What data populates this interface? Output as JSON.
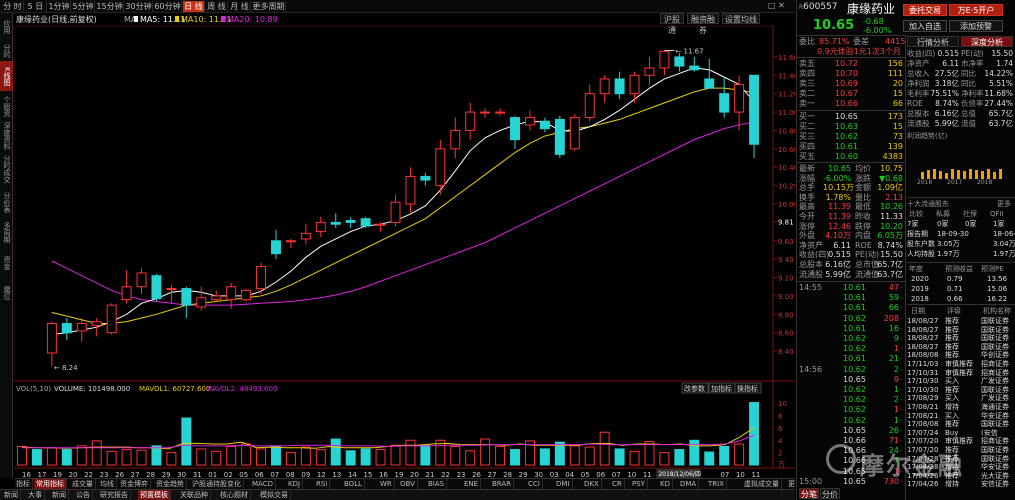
{
  "toolbar": {
    "tabs": [
      "分 时",
      "5 日",
      "1分钟",
      "5分钟",
      "15分钟",
      "30分钟",
      "60分钟",
      "日 线",
      "周 线",
      "月 线",
      "更多周期"
    ],
    "active_index": 7,
    "right_buttons": [
      "沪股通",
      "融资融券",
      "设置均线"
    ]
  },
  "left_strip": [
    {
      "label": "应用",
      "active": false
    },
    {
      "label": "分时图",
      "active": false
    },
    {
      "label": "K线图",
      "active": true
    },
    {
      "label": "个股资料",
      "active": false
    },
    {
      "label": "深度资料",
      "active": false
    },
    {
      "label": "分时成交",
      "active": false
    },
    {
      "label": "分价表",
      "active": false
    },
    {
      "label": "多周期",
      "active": false
    },
    {
      "label": "资金",
      "active": false
    },
    {
      "label": "魔位",
      "active": false
    }
  ],
  "chart_header": {
    "name": "康缘药业",
    "mode": "(日线,前复权)",
    "ma_label": "MA",
    "ma5": "MA5: 11.11",
    "ma10": "MA10: 11.21",
    "ma20": "MA20: 10.89",
    "ma5_color": "#ffffff",
    "ma10_color": "#e8d000",
    "ma20_color": "#e020e0",
    "high_label": "11.67",
    "low_label": "8.24"
  },
  "price_axis": [
    "11.60",
    "11.40",
    "11.20",
    "11.00",
    "10.80",
    "10.60",
    "10.40",
    "10.20",
    "10.00",
    "9.81",
    "9.60",
    "9.40",
    "9.20",
    "9.00",
    "8.80",
    "8.60",
    "8.40"
  ],
  "volume_header": {
    "vol": "VOL(5,10)",
    "volume": "VOLUME: 101498.000",
    "mavol1": "MAVOL1: 60727.600",
    "mavol2": "MAVOL2: 48493.600",
    "buttons": [
      "改参数",
      "加指标",
      "换指标"
    ]
  },
  "volume_axis": [
    "10",
    "8",
    "6",
    "4",
    "2"
  ],
  "volume_unit": "万",
  "date_axis": [
    "16",
    "17",
    "19",
    "20",
    "22",
    "23",
    "26",
    "27",
    "28",
    "29",
    "30",
    "31",
    "01",
    "02",
    "05",
    "06",
    "07",
    "08",
    "09",
    "12",
    "13",
    "14",
    "15",
    "16",
    "19",
    "20",
    "21",
    "22",
    "23",
    "26",
    "27",
    "28",
    "29",
    "30",
    "03",
    "04",
    "05",
    "06",
    "07",
    "10",
    "11",
    "12",
    "04",
    "05",
    "06",
    "07",
    "10",
    "11"
  ],
  "date_highlight": "2018/12/06/四",
  "indicator_tabs": [
    "指标",
    "常用指标",
    "成交量",
    "均线",
    "资金博弈",
    "资金趋势",
    "沪股通持股变化",
    "MACD",
    "KDJ",
    "RSI",
    "BOLL",
    "WR",
    "OBV",
    "BIAS",
    "ENE",
    "BRAR",
    "CCI",
    "DMI",
    "DKX",
    "CR",
    "PSY",
    "KD",
    "DMA",
    "TRIX",
    "虚拟成交量",
    "更多指标"
  ],
  "indicator_active": 1,
  "nav_tabs": [
    "新闻",
    "大事",
    "新闻",
    "公告",
    "研究报告",
    "预置模板",
    "关联品种",
    "核心题材",
    "模拟交易"
  ],
  "nav_active": 5,
  "chart_data": {
    "type": "candlestick",
    "ylim": [
      8.24,
      11.78
    ],
    "candles": [
      {
        "o": 8.38,
        "h": 8.72,
        "l": 8.24,
        "c": 8.7
      },
      {
        "o": 8.7,
        "h": 8.76,
        "l": 8.52,
        "c": 8.6
      },
      {
        "o": 8.62,
        "h": 8.76,
        "l": 8.5,
        "c": 8.7
      },
      {
        "o": 8.68,
        "h": 8.76,
        "l": 8.56,
        "c": 8.72
      },
      {
        "o": 8.6,
        "h": 8.92,
        "l": 8.58,
        "c": 8.9
      },
      {
        "o": 8.96,
        "h": 9.28,
        "l": 8.92,
        "c": 9.1
      },
      {
        "o": 9.1,
        "h": 9.3,
        "l": 9.02,
        "c": 9.25
      },
      {
        "o": 9.22,
        "h": 9.24,
        "l": 8.94,
        "c": 8.97
      },
      {
        "o": 9.08,
        "h": 9.12,
        "l": 8.92,
        "c": 9.08
      },
      {
        "o": 9.08,
        "h": 9.1,
        "l": 8.76,
        "c": 8.9
      },
      {
        "o": 8.88,
        "h": 9.1,
        "l": 8.84,
        "c": 8.98
      },
      {
        "o": 8.96,
        "h": 9.06,
        "l": 8.94,
        "c": 9.0
      },
      {
        "o": 8.96,
        "h": 9.14,
        "l": 8.86,
        "c": 9.1
      },
      {
        "o": 8.96,
        "h": 9.08,
        "l": 8.94,
        "c": 9.06
      },
      {
        "o": 9.08,
        "h": 9.36,
        "l": 9.02,
        "c": 9.32
      },
      {
        "o": 9.6,
        "h": 9.72,
        "l": 9.4,
        "c": 9.46
      },
      {
        "o": 9.6,
        "h": 9.62,
        "l": 9.52,
        "c": 9.6
      },
      {
        "o": 9.62,
        "h": 9.78,
        "l": 9.56,
        "c": 9.68
      },
      {
        "o": 9.7,
        "h": 9.86,
        "l": 9.64,
        "c": 9.8
      },
      {
        "o": 9.8,
        "h": 9.9,
        "l": 9.74,
        "c": 9.78
      },
      {
        "o": 9.82,
        "h": 9.86,
        "l": 9.74,
        "c": 9.8
      },
      {
        "o": 9.84,
        "h": 9.86,
        "l": 9.74,
        "c": 9.76
      },
      {
        "o": 9.78,
        "h": 9.8,
        "l": 9.7,
        "c": 9.78
      },
      {
        "o": 9.8,
        "h": 10.1,
        "l": 9.76,
        "c": 10.02
      },
      {
        "o": 10.0,
        "h": 10.4,
        "l": 9.9,
        "c": 10.3
      },
      {
        "o": 10.3,
        "h": 10.34,
        "l": 10.2,
        "c": 10.26
      },
      {
        "o": 10.2,
        "h": 10.7,
        "l": 10.1,
        "c": 10.6
      },
      {
        "o": 10.6,
        "h": 10.94,
        "l": 10.5,
        "c": 10.8
      },
      {
        "o": 10.8,
        "h": 11.1,
        "l": 10.7,
        "c": 11.0
      },
      {
        "o": 11.0,
        "h": 11.04,
        "l": 10.94,
        "c": 11.0
      },
      {
        "o": 11.0,
        "h": 11.04,
        "l": 10.96,
        "c": 11.0
      },
      {
        "o": 10.94,
        "h": 10.96,
        "l": 10.6,
        "c": 10.7
      },
      {
        "o": 10.86,
        "h": 11.02,
        "l": 10.8,
        "c": 10.94
      },
      {
        "o": 10.9,
        "h": 10.94,
        "l": 10.78,
        "c": 10.82
      },
      {
        "o": 10.92,
        "h": 10.96,
        "l": 10.5,
        "c": 10.54
      },
      {
        "o": 10.6,
        "h": 10.98,
        "l": 10.58,
        "c": 10.94
      },
      {
        "o": 10.94,
        "h": 11.3,
        "l": 10.9,
        "c": 11.2
      },
      {
        "o": 11.2,
        "h": 11.4,
        "l": 11.1,
        "c": 11.36
      },
      {
        "o": 11.36,
        "h": 11.44,
        "l": 11.14,
        "c": 11.2
      },
      {
        "o": 11.2,
        "h": 11.44,
        "l": 11.1,
        "c": 11.4
      },
      {
        "o": 11.4,
        "h": 11.6,
        "l": 11.3,
        "c": 11.48
      },
      {
        "o": 11.48,
        "h": 11.67,
        "l": 11.4,
        "c": 11.66
      },
      {
        "o": 11.6,
        "h": 11.64,
        "l": 11.44,
        "c": 11.5
      },
      {
        "o": 11.5,
        "h": 11.6,
        "l": 11.44,
        "c": 11.46
      },
      {
        "o": 11.36,
        "h": 11.58,
        "l": 11.26,
        "c": 11.26
      },
      {
        "o": 11.2,
        "h": 11.38,
        "l": 10.94,
        "c": 11.0
      },
      {
        "o": 11.0,
        "h": 11.4,
        "l": 10.8,
        "c": 11.3
      },
      {
        "o": 11.4,
        "h": 11.4,
        "l": 10.5,
        "c": 10.65
      }
    ],
    "ma5": [
      8.58,
      8.6,
      8.63,
      8.66,
      8.72,
      8.8,
      8.92,
      8.97,
      9.04,
      9.06,
      9.04,
      9.0,
      9.0,
      9.0,
      9.05,
      9.15,
      9.27,
      9.42,
      9.54,
      9.62,
      9.7,
      9.76,
      9.78,
      9.82,
      9.89,
      9.98,
      10.15,
      10.36,
      10.58,
      10.72,
      10.8,
      10.86,
      10.9,
      10.89,
      10.8,
      10.79,
      10.84,
      10.92,
      11.02,
      11.14,
      11.26,
      11.36,
      11.42,
      11.48,
      11.46,
      11.38,
      11.3,
      11.11
    ],
    "ma10": [
      8.82,
      8.78,
      8.74,
      8.7,
      8.7,
      8.72,
      8.76,
      8.8,
      8.85,
      8.9,
      8.92,
      8.94,
      8.96,
      8.98,
      9.0,
      9.05,
      9.12,
      9.2,
      9.28,
      9.36,
      9.44,
      9.52,
      9.6,
      9.68,
      9.76,
      9.84,
      9.96,
      10.08,
      10.2,
      10.32,
      10.44,
      10.56,
      10.66,
      10.74,
      10.78,
      10.82,
      10.84,
      10.88,
      10.92,
      10.98,
      11.04,
      11.1,
      11.16,
      11.22,
      11.26,
      11.26,
      11.24,
      11.21
    ],
    "ma20": [
      9.38,
      9.3,
      9.22,
      9.14,
      9.06,
      9.0,
      8.96,
      8.94,
      8.92,
      8.9,
      8.9,
      8.9,
      8.9,
      8.91,
      8.92,
      8.93,
      8.94,
      8.96,
      8.98,
      9.01,
      9.05,
      9.1,
      9.16,
      9.22,
      9.28,
      9.34,
      9.4,
      9.46,
      9.52,
      9.58,
      9.66,
      9.74,
      9.82,
      9.9,
      9.98,
      10.06,
      10.14,
      10.22,
      10.3,
      10.38,
      10.46,
      10.54,
      10.62,
      10.7,
      10.76,
      10.82,
      10.86,
      10.89
    ],
    "volumes": [
      3.0,
      2.5,
      2.8,
      2.5,
      3.1,
      3.9,
      2.2,
      2.5,
      2.4,
      3.1,
      2.0,
      7.6,
      2.6,
      2.2,
      3.0,
      3.4,
      2.6,
      3.1,
      2.0,
      2.9,
      2.5,
      4.2,
      2.3,
      2.6,
      2.5,
      3.2,
      4.0,
      3.2,
      4.0,
      3.0,
      2.3,
      4.2,
      3.0,
      2.5,
      3.9,
      2.6,
      3.7,
      3.1,
      2.9,
      5.3,
      2.6,
      2.2,
      3.8,
      2.0,
      2.5,
      4.0,
      2.1,
      3.0,
      3.4,
      10.1
    ],
    "mavol1": [
      2.9,
      2.8,
      2.8,
      2.7,
      2.8,
      2.9,
      2.9,
      2.9,
      2.8,
      2.8,
      2.6,
      3.5,
      3.5,
      3.4,
      3.4,
      3.7,
      2.8,
      2.9,
      2.8,
      2.8,
      2.7,
      3.0,
      2.8,
      2.8,
      2.8,
      3.0,
      3.2,
      3.2,
      3.4,
      3.5,
      3.3,
      3.3,
      3.3,
      3.2,
      3.4,
      3.2,
      3.2,
      3.2,
      3.2,
      3.5,
      3.5,
      3.2,
      3.4,
      3.4,
      3.3,
      3.4,
      3.1,
      3.1,
      3.3,
      4.5,
      6.07
    ],
    "mavol2": [
      2.8,
      2.8,
      2.8,
      2.8,
      2.8,
      2.8,
      2.8,
      2.8,
      2.8,
      2.8,
      2.8,
      3.2,
      3.1,
      3.1,
      3.1,
      3.2,
      3.1,
      3.1,
      3.1,
      3.2,
      3.2,
      3.2,
      3.1,
      3.1,
      3.1,
      3.0,
      3.1,
      3.1,
      3.1,
      3.2,
      3.2,
      3.2,
      3.3,
      3.3,
      3.3,
      3.3,
      3.3,
      3.3,
      3.3,
      3.4,
      3.3,
      3.3,
      3.3,
      3.3,
      3.3,
      3.3,
      3.3,
      3.3,
      3.4,
      3.9,
      4.85
    ]
  },
  "quote": {
    "code_prefix": "R",
    "code": "600557",
    "name": "康缘药业",
    "price": "10.65",
    "change": "-0.68",
    "change_pct": "-6.00%",
    "btn_commission": "委托交易",
    "btn_open": "万E·5开户",
    "btn_watch": "加入自选",
    "btn_add": "添加预警",
    "webi_label": "委比",
    "webi_val": "85.71%",
    "weicha_label": "委差",
    "weicha_val": "4415",
    "fund_note": "0.9元体验1元1次3个月",
    "asks": [
      {
        "label": "卖五",
        "price": "10.72",
        "vol": "156"
      },
      {
        "label": "卖四",
        "price": "10.70",
        "vol": "111"
      },
      {
        "label": "卖三",
        "price": "10.69",
        "vol": "20"
      },
      {
        "label": "卖二",
        "price": "10.67",
        "vol": "15"
      },
      {
        "label": "卖一",
        "price": "10.66",
        "vol": "66"
      }
    ],
    "bids": [
      {
        "label": "买一",
        "price": "10.65",
        "vol": "173"
      },
      {
        "label": "买二",
        "price": "10.63",
        "vol": "15"
      },
      {
        "label": "买三",
        "price": "10.62",
        "vol": "73"
      },
      {
        "label": "买四",
        "price": "10.61",
        "vol": "139"
      },
      {
        "label": "买五",
        "price": "10.60",
        "vol": "4383"
      }
    ],
    "stats": [
      {
        "l1": "最新",
        "v1": "10.65",
        "c1": "green",
        "l2": "均价",
        "v2": "10.75",
        "c2": "yellow"
      },
      {
        "l1": "涨幅",
        "v1": "-6.00%",
        "c1": "green",
        "l2": "涨跌",
        "v2": "▼0.68",
        "c2": "green"
      },
      {
        "l1": "总手",
        "v1": "10.15万",
        "c1": "yellow",
        "l2": "金额",
        "v2": "1.09亿",
        "c2": "yellow"
      },
      {
        "l1": "换手",
        "v1": "1.78%",
        "c1": "yellow",
        "l2": "量比",
        "v2": "2.13",
        "c2": "red"
      },
      {
        "l1": "最高",
        "v1": "11.39",
        "c1": "red",
        "l2": "最低",
        "v2": "10.26",
        "c2": "green"
      },
      {
        "l1": "今开",
        "v1": "11.39",
        "c1": "red",
        "l2": "昨收",
        "v2": "11.33",
        "c2": "white"
      },
      {
        "l1": "涨停",
        "v1": "12.46",
        "c1": "red",
        "l2": "跌停",
        "v2": "10.20",
        "c2": "green"
      },
      {
        "l1": "外盘",
        "v1": "4.10万",
        "c1": "red",
        "l2": "内盘",
        "v2": "6.05万",
        "c2": "green"
      },
      {
        "l1": "净资产",
        "v1": "6.11",
        "c1": "white",
        "l2": "ROE",
        "v2": "8.74%",
        "c2": "white"
      },
      {
        "l1": "收益(四)",
        "v1": "0.515",
        "c1": "white",
        "l2": "PE(动)",
        "v2": "15.50",
        "c2": "white"
      },
      {
        "l1": "总股本",
        "v1": "6.16亿",
        "c1": "white",
        "l2": "总市值",
        "v2": "65.7亿",
        "c2": "white"
      },
      {
        "l1": "流通股",
        "v1": "5.99亿",
        "c1": "white",
        "l2": "流通值",
        "v2": "63.7亿",
        "c2": "white"
      }
    ],
    "ticks": [
      {
        "t": "14:55",
        "p": "10.61",
        "v": "47"
      },
      {
        "t": "",
        "p": "10.61",
        "v": "59"
      },
      {
        "t": "",
        "p": "10.61",
        "v": "66"
      },
      {
        "t": "",
        "p": "10.62",
        "v": "208"
      },
      {
        "t": "",
        "p": "10.61",
        "v": "16"
      },
      {
        "t": "",
        "p": "10.62",
        "v": "9"
      },
      {
        "t": "",
        "p": "10.62",
        "v": "1"
      },
      {
        "t": "",
        "p": "10.61",
        "v": "21"
      },
      {
        "t": "14:56",
        "p": "10.62",
        "v": "2"
      },
      {
        "t": "",
        "p": "10.65",
        "v": "9"
      },
      {
        "t": "",
        "p": "10.62",
        "v": "1"
      },
      {
        "t": "",
        "p": "10.62",
        "v": "2"
      },
      {
        "t": "",
        "p": "10.62",
        "v": "1"
      },
      {
        "t": "",
        "p": "10.62",
        "v": "1"
      },
      {
        "t": "",
        "p": "10.65",
        "v": "26"
      },
      {
        "t": "",
        "p": "10.66",
        "v": "71"
      },
      {
        "t": "",
        "p": "10.66",
        "v": "24"
      },
      {
        "t": "",
        "p": "10.66",
        "v": "7"
      },
      {
        "t": "",
        "p": "10.65",
        "v": "1"
      },
      {
        "t": "15:00",
        "p": "10.65",
        "v": "730"
      }
    ],
    "f10_tabs": [
      "行情分析",
      "深度分析"
    ],
    "f10_rows": [
      {
        "l1": "收益(四)",
        "v1": "0.515",
        "l2": "PE(动)",
        "v2": "15.50"
      },
      {
        "l1": "净资产",
        "v1": "6.11",
        "l2": "市净率",
        "v2": "1.74"
      },
      {
        "l1": "总收入",
        "v1": "27.5亿",
        "l2": "同比",
        "v2": "14.22%"
      },
      {
        "l1": "净利润",
        "v1": "3.18亿",
        "l2": "同比",
        "v2": "5.51%"
      },
      {
        "l1": "毛利率",
        "v1": "75.51%",
        "l2": "净利率",
        "v2": "11.68%"
      },
      {
        "l1": "ROE",
        "v1": "8.74%",
        "l2": "负债率",
        "v2": "27.44%"
      },
      {
        "l1": "总股本",
        "v1": "6.16亿",
        "l2": "总值",
        "v2": "65.7亿"
      },
      {
        "l1": "流通股",
        "v1": "5.99亿",
        "l2": "流值",
        "v2": "63.7亿"
      }
    ],
    "profit_label": "利润趋势(亿)",
    "profit_years": [
      "2016",
      "2017",
      "2018"
    ],
    "profit_values": [
      0.7,
      0.9,
      1.0,
      0.8,
      0.6,
      1.0,
      0.9,
      0.8,
      1.0,
      0.9,
      0.8,
      1.0,
      0.7,
      1.0
    ],
    "holders_title": "十大流通股东",
    "holders_more": "更多",
    "holders_head": [
      "比较",
      "私募",
      "社保",
      "QFII"
    ],
    "holders": [
      {
        "l": "7家",
        "v": [
          "0家",
          "0家",
          "1家"
        ]
      },
      {
        "l": "报告期",
        "v": [
          "18-09-30",
          "",
          "18-06-30"
        ]
      },
      {
        "l": "股东户数",
        "v": [
          "3.05万",
          "",
          "3.04万"
        ]
      },
      {
        "l": "人均持股",
        "v": [
          "1.97万",
          "",
          "1.97万"
        ]
      }
    ],
    "earn_head": [
      "年度",
      "预测收益",
      "预测PE"
    ],
    "earn_rows": [
      {
        "y": "2020",
        "e": "0.79",
        "pe": "13.56"
      },
      {
        "y": "2019",
        "e": "0.71",
        "pe": "15.06"
      },
      {
        "y": "2018",
        "e": "0.66",
        "pe": "16.22"
      }
    ],
    "rating_head": [
      "日期",
      "评级",
      "机构名称"
    ],
    "ratings": [
      {
        "d": "18/08/27",
        "r": "推荐",
        "o": "国联证券"
      },
      {
        "d": "18/08/27",
        "r": "推荐",
        "o": "国联证券"
      },
      {
        "d": "18/08/27",
        "r": "推荐",
        "o": "国联证券"
      },
      {
        "d": "18/08/27",
        "r": "推荐",
        "o": "国联证券"
      },
      {
        "d": "18/08/08",
        "r": "推荐",
        "o": "华创证券"
      },
      {
        "d": "17/11/03",
        "r": "审慎推荐",
        "o": "招商证券"
      },
      {
        "d": "17/10/31",
        "r": "审慎推荐",
        "o": "招商证券"
      },
      {
        "d": "17/10/30",
        "r": "买入",
        "o": "广发证券"
      },
      {
        "d": "17/10/30",
        "r": "推荐",
        "o": "国联证券"
      },
      {
        "d": "17/08/29",
        "r": "买入",
        "o": "广发证券"
      },
      {
        "d": "17/08/21",
        "r": "增持",
        "o": "海通证券"
      },
      {
        "d": "17/08/21",
        "r": "买入",
        "o": "华安证券"
      },
      {
        "d": "17/08/08",
        "r": "推荐",
        "o": "国联证券"
      },
      {
        "d": "17/07/24",
        "r": "Buy",
        "o": "(安信"
      },
      {
        "d": "17/07/20",
        "r": "审慎推荐",
        "o": "招商证券"
      },
      {
        "d": "17/07/20",
        "r": "推荐",
        "o": "国联证券"
      },
      {
        "d": "17/04/28",
        "r": "推荐",
        "o": "国联证券"
      },
      {
        "d": "17/04/28",
        "r": "增持",
        "o": "华安证券"
      },
      {
        "d": "17/04/26",
        "r": "推荐",
        "o": "光大证券"
      },
      {
        "d": "17/04/26",
        "r": "增持",
        "o": "安信证券"
      }
    ],
    "bottom_tabs": [
      "分笔",
      "分价"
    ],
    "watermark": "摩尔金融"
  }
}
